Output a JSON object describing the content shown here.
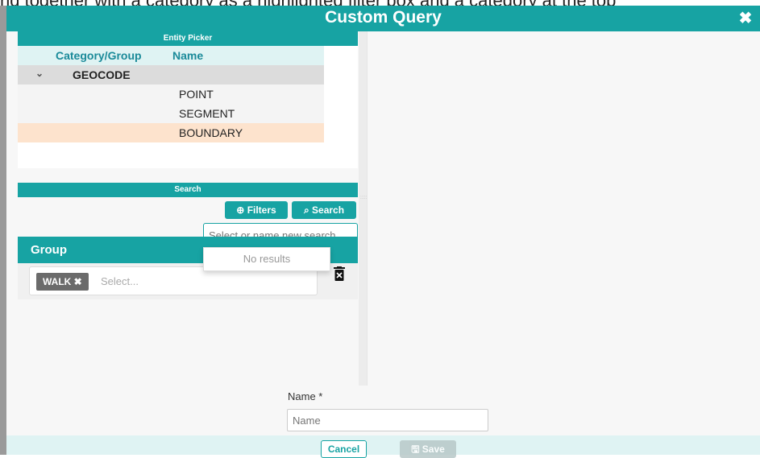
{
  "top_cutoff_text": "nd together with a category as a highlighted filter box and a category at the top",
  "modal": {
    "title": "Custom Query",
    "close_icon": "close-icon"
  },
  "entity_picker": {
    "title": "Entity Picker",
    "columns": [
      "Category/Group",
      "Name"
    ],
    "groups": [
      {
        "name": "GEOCODE",
        "expanded": true,
        "items": [
          {
            "name": "POINT",
            "selected": false
          },
          {
            "name": "SEGMENT",
            "selected": false
          },
          {
            "name": "BOUNDARY",
            "selected": true
          }
        ]
      }
    ]
  },
  "search": {
    "title": "Search",
    "filters_label": "Filters",
    "search_label": "Search",
    "input_placeholder": "Select or name new search",
    "dropdown_empty": "No results"
  },
  "group": {
    "title": "Group",
    "tags": [
      "WALK"
    ],
    "select_placeholder": "Select..."
  },
  "form": {
    "name_label": "Name *",
    "name_placeholder": "Name"
  },
  "footer": {
    "cancel_label": "Cancel",
    "save_label": "Save"
  },
  "colors": {
    "accent": "#17a3a3",
    "selected_row": "#fde3cd",
    "tag": "#6b6b6b"
  }
}
